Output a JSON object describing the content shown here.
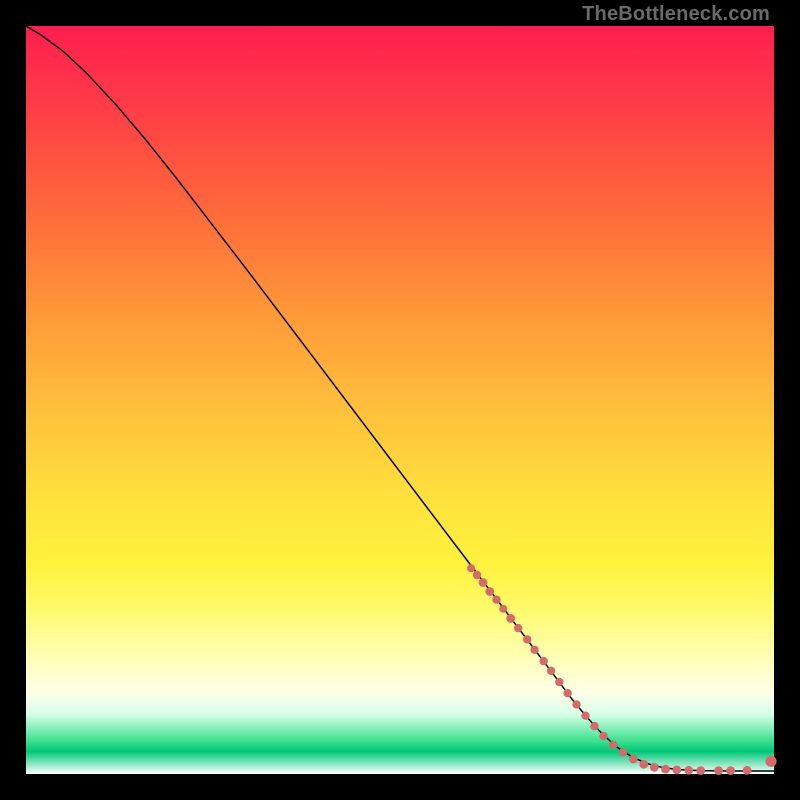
{
  "watermark": "TheBottleneck.com",
  "colors": {
    "marker_fill": "#d46a6a",
    "curve_stroke": "#000000"
  },
  "chart_data": {
    "type": "line",
    "title": "",
    "xlabel": "",
    "ylabel": "",
    "xlim": [
      0,
      100
    ],
    "ylim": [
      0,
      100
    ],
    "grid": false,
    "legend": false,
    "series": [
      {
        "name": "curve",
        "style": "line",
        "x": [
          0,
          2,
          5,
          8,
          12,
          16,
          20,
          25,
          30,
          35,
          40,
          45,
          50,
          55,
          60,
          65,
          70,
          73,
          75,
          77,
          79,
          81,
          83,
          85,
          87,
          90,
          94,
          100
        ],
        "y": [
          100,
          98.8,
          96.6,
          93.8,
          89.5,
          84.8,
          79.8,
          73.3,
          66.8,
          60.2,
          53.6,
          47.0,
          40.4,
          33.8,
          27.2,
          20.6,
          14.0,
          10.0,
          7.6,
          5.4,
          3.6,
          2.3,
          1.4,
          0.9,
          0.6,
          0.45,
          0.4,
          0.4
        ]
      },
      {
        "name": "markers",
        "style": "scatter",
        "points": [
          {
            "x": 59.5,
            "y": 27.5,
            "r": 4.0
          },
          {
            "x": 60.3,
            "y": 26.6,
            "r": 4.2
          },
          {
            "x": 61.1,
            "y": 25.6,
            "r": 4.4
          },
          {
            "x": 62.0,
            "y": 24.4,
            "r": 4.4
          },
          {
            "x": 62.9,
            "y": 23.3,
            "r": 4.2
          },
          {
            "x": 63.8,
            "y": 22.1,
            "r": 4.0
          },
          {
            "x": 64.8,
            "y": 20.8,
            "r": 4.4
          },
          {
            "x": 65.8,
            "y": 19.5,
            "r": 4.2
          },
          {
            "x": 67.0,
            "y": 18.0,
            "r": 4.2
          },
          {
            "x": 68.0,
            "y": 16.6,
            "r": 4.2
          },
          {
            "x": 69.2,
            "y": 15.1,
            "r": 4.2
          },
          {
            "x": 70.2,
            "y": 13.8,
            "r": 4.2
          },
          {
            "x": 71.3,
            "y": 12.3,
            "r": 4.2
          },
          {
            "x": 72.4,
            "y": 10.8,
            "r": 4.2
          },
          {
            "x": 73.6,
            "y": 9.3,
            "r": 4.2
          },
          {
            "x": 74.8,
            "y": 7.8,
            "r": 4.2
          },
          {
            "x": 76.0,
            "y": 6.4,
            "r": 4.2
          },
          {
            "x": 77.2,
            "y": 5.1,
            "r": 4.2
          },
          {
            "x": 78.5,
            "y": 3.9,
            "r": 4.2
          },
          {
            "x": 79.8,
            "y": 2.9,
            "r": 4.2
          },
          {
            "x": 81.2,
            "y": 2.0,
            "r": 4.4
          },
          {
            "x": 82.6,
            "y": 1.3,
            "r": 4.4
          },
          {
            "x": 84.0,
            "y": 0.9,
            "r": 4.4
          },
          {
            "x": 85.5,
            "y": 0.65,
            "r": 4.4
          },
          {
            "x": 87.0,
            "y": 0.55,
            "r": 4.4
          },
          {
            "x": 88.6,
            "y": 0.5,
            "r": 4.4
          },
          {
            "x": 90.2,
            "y": 0.45,
            "r": 4.4
          },
          {
            "x": 92.6,
            "y": 0.45,
            "r": 4.4
          },
          {
            "x": 94.2,
            "y": 0.45,
            "r": 4.4
          },
          {
            "x": 96.4,
            "y": 0.5,
            "r": 4.4
          },
          {
            "x": 99.6,
            "y": 1.7,
            "r": 5.6
          }
        ]
      }
    ]
  }
}
